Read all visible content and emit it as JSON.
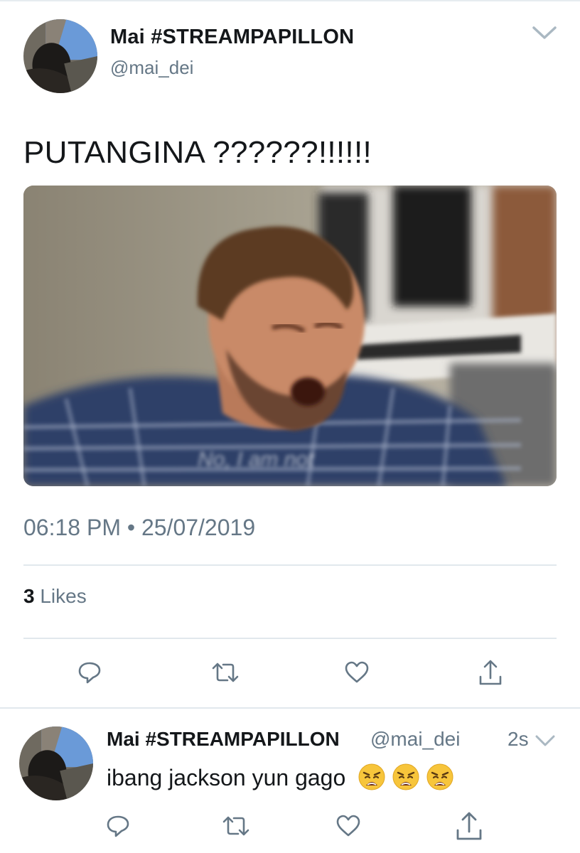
{
  "tweet": {
    "author": {
      "display_name": "Mai #STREAMPAPILLON",
      "handle": "@mai_dei"
    },
    "text": "PUTANGINA ??????!!!!!!",
    "media": {
      "caption": "No, I am not"
    },
    "timestamp": "06:18 PM • 25/07/2019",
    "likes_count": "3",
    "likes_label": "Likes",
    "actions": [
      "reply-icon",
      "retweet-icon",
      "like-icon",
      "share-icon"
    ]
  },
  "reply": {
    "author": {
      "display_name": "Mai #STREAMPAPILLON",
      "handle": "@mai_dei"
    },
    "time": "2s",
    "text": "ibang jackson yun gago",
    "emojis": [
      "weary-face",
      "weary-face",
      "weary-face"
    ],
    "actions": [
      "reply-icon",
      "retweet-icon",
      "like-icon",
      "share-icon"
    ]
  },
  "colors": {
    "text": "#14171a",
    "secondary": "#657786",
    "divider": "#e1e8ed"
  }
}
